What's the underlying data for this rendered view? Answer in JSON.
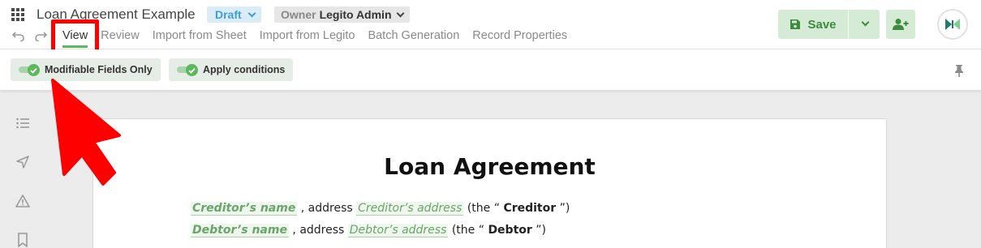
{
  "header": {
    "title": "Loan Agreement Example",
    "status": "Draft",
    "owner_label": "Owner",
    "owner_value": "Legito Admin",
    "tabs": [
      {
        "label": "View",
        "active": true
      },
      {
        "label": "Review"
      },
      {
        "label": "Import from Sheet"
      },
      {
        "label": "Import from Legito"
      },
      {
        "label": "Batch Generation"
      },
      {
        "label": "Record Properties"
      }
    ],
    "save_label": "Save"
  },
  "toolbar": {
    "toggle_modifiable": "Modifiable Fields Only",
    "toggle_conditions": "Apply conditions"
  },
  "document": {
    "heading": "Loan Agreement",
    "line1": {
      "field_name": "Creditor’s name",
      "sep": ", address",
      "field_address": "Creditor’s address",
      "pre": "(the “",
      "term": "Creditor",
      "post": "”)"
    },
    "line2": {
      "field_name": "Debtor’s name",
      "sep": ", address",
      "field_address": "Debtor’s address",
      "pre": "(the “",
      "term": "Debtor",
      "post": "”)"
    }
  },
  "colors": {
    "accent_green": "#5cb85c",
    "status_blue": "#3ca0d8",
    "annotation_red": "#ff0000"
  }
}
